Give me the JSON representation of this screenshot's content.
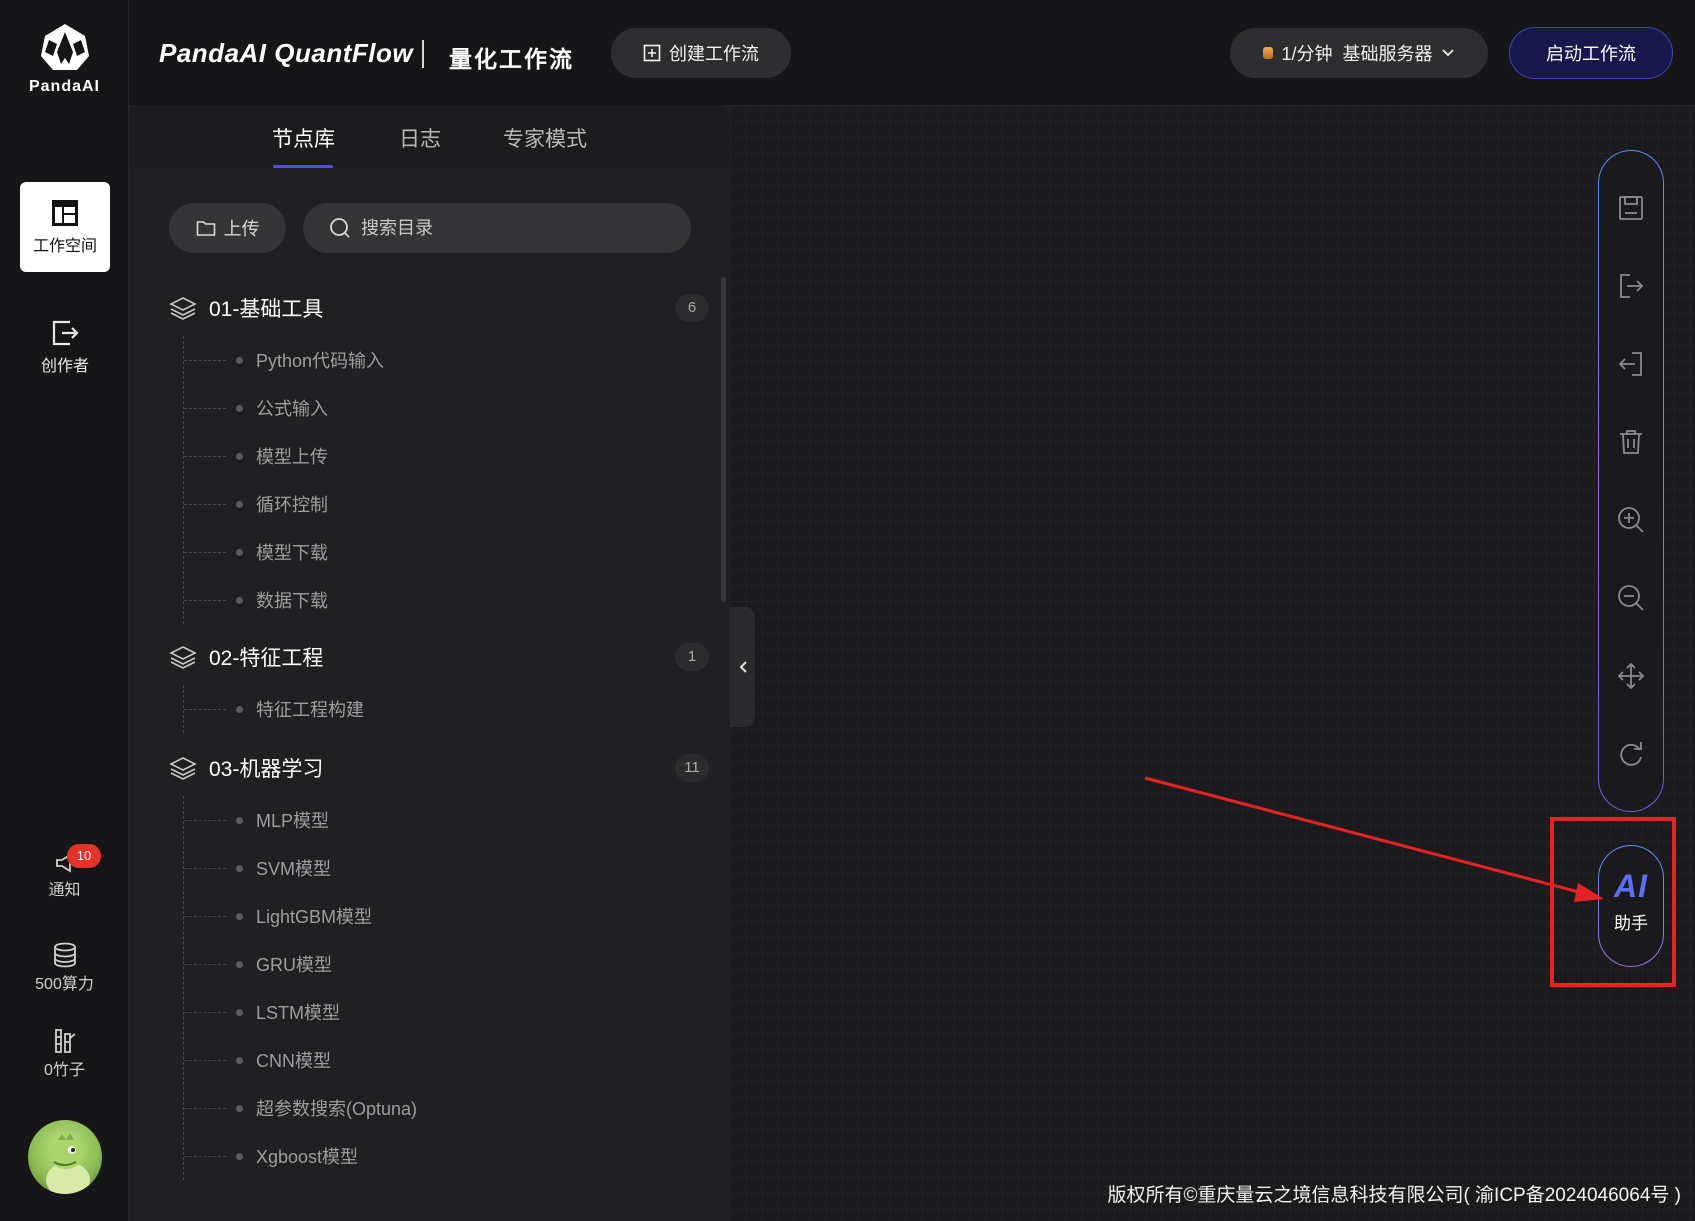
{
  "logo": {
    "text": "PandaAI"
  },
  "rail": {
    "workspace_label": "工作空间",
    "creator_label": "创作者",
    "notify_label": "通知",
    "notify_badge": "10",
    "compute_label": "500算力",
    "bamboo_label": "0竹子"
  },
  "header": {
    "brand": "PandaAI QuantFlow",
    "brand_cn": "量化工作流",
    "create_label": "创建工作流",
    "server_label": "1/分钟  基础服务器",
    "start_label": "启动工作流"
  },
  "panel": {
    "tabs": [
      "节点库",
      "日志",
      "专家模式"
    ],
    "active_tab": "节点库",
    "upload_label": "上传",
    "search_placeholder": "搜索目录",
    "groups": [
      {
        "title": "01-基础工具",
        "count": "6",
        "items": [
          "Python代码输入",
          "公式输入",
          "模型上传",
          "循环控制",
          "模型下载",
          "数据下载"
        ]
      },
      {
        "title": "02-特征工程",
        "count": "1",
        "items": [
          "特征工程构建"
        ]
      },
      {
        "title": "03-机器学习",
        "count": "11",
        "items": [
          "MLP模型",
          "SVM模型",
          "LightGBM模型",
          "GRU模型",
          "LSTM模型",
          "CNN模型",
          "超参数搜索(Optuna)",
          "Xgboost模型"
        ]
      }
    ]
  },
  "canvas": {
    "tools": [
      "save-icon",
      "export-icon",
      "import-icon",
      "delete-icon",
      "zoom-in-icon",
      "zoom-out-icon",
      "move-icon",
      "refresh-icon"
    ],
    "ai_logo": "AI",
    "ai_label": "助手",
    "highlight_color": "#e62222"
  },
  "footer": {
    "copyright": "版权所有©重庆量云之境信息科技有限公司( 渝ICP备2024046064号 )"
  },
  "colors": {
    "accent": "#4b4fe3",
    "start_button": "#17194d",
    "badge": "#e5332a"
  }
}
